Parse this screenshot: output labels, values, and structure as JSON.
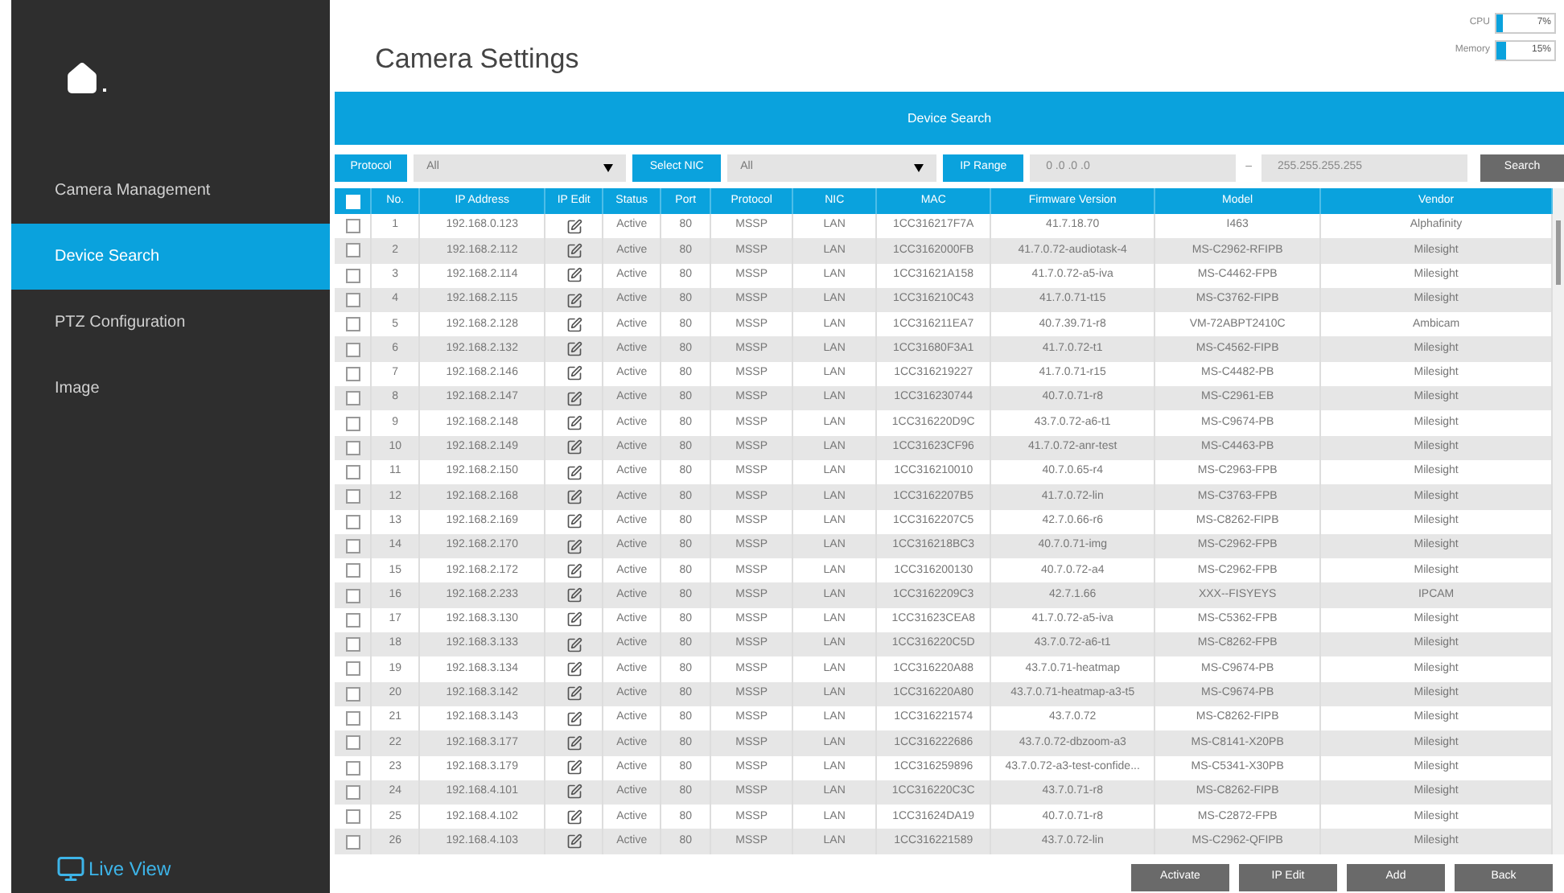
{
  "sidebar": {
    "items": [
      {
        "label": "Camera Management",
        "selected": false
      },
      {
        "label": "Device Search",
        "selected": true
      },
      {
        "label": "PTZ Configuration",
        "selected": false
      },
      {
        "label": "Image",
        "selected": false
      }
    ],
    "live_view": "Live View"
  },
  "header": {
    "title": "Camera Settings",
    "meters": [
      {
        "label": "CPU",
        "level": 0.07,
        "reading": "7%"
      },
      {
        "label": "Memory",
        "level": 0.15,
        "reading": "15%"
      }
    ]
  },
  "section_title": "Device Search",
  "filters": {
    "protocol": {
      "label": "Protocol",
      "value": "All"
    },
    "nic": {
      "label": "Select NIC",
      "value": "All"
    },
    "ip_range": {
      "label": "IP Range",
      "from": "0 .0 .0 .0",
      "separator": "–",
      "to": "255.255.255.255"
    },
    "search": "Search"
  },
  "table": {
    "select_all": {
      "checked": false
    },
    "columns": [
      "No.",
      "IP Address",
      "IP Edit",
      "Status",
      "Port",
      "Protocol",
      "NIC",
      "MAC",
      "Firmware Version",
      "Model",
      "Vendor"
    ],
    "rows": [
      {
        "checked": false,
        "cells": [
          "1",
          "192.168.0.123",
          "",
          "Active",
          "80",
          "MSSP",
          "LAN",
          "1CC316217F7A",
          "41.7.18.70",
          "I463",
          "Alphafinity"
        ]
      },
      {
        "checked": false,
        "cells": [
          "2",
          "192.168.2.112",
          "",
          "Active",
          "80",
          "MSSP",
          "LAN",
          "1CC3162000FB",
          "41.7.0.72-audiotask-4",
          "MS-C2962-RFIPB",
          "Milesight"
        ]
      },
      {
        "checked": false,
        "cells": [
          "3",
          "192.168.2.114",
          "",
          "Active",
          "80",
          "MSSP",
          "LAN",
          "1CC31621A158",
          "41.7.0.72-a5-iva",
          "MS-C4462-FPB",
          "Milesight"
        ]
      },
      {
        "checked": false,
        "cells": [
          "4",
          "192.168.2.115",
          "",
          "Active",
          "80",
          "MSSP",
          "LAN",
          "1CC316210C43",
          "41.7.0.71-t15",
          "MS-C3762-FIPB",
          "Milesight"
        ]
      },
      {
        "checked": false,
        "cells": [
          "5",
          "192.168.2.128",
          "",
          "Active",
          "80",
          "MSSP",
          "LAN",
          "1CC316211EA7",
          "40.7.39.71-r8",
          "VM-72ABPT2410C",
          "Ambicam"
        ]
      },
      {
        "checked": false,
        "cells": [
          "6",
          "192.168.2.132",
          "",
          "Active",
          "80",
          "MSSP",
          "LAN",
          "1CC31680F3A1",
          "41.7.0.72-t1",
          "MS-C4562-FIPB",
          "Milesight"
        ]
      },
      {
        "checked": false,
        "cells": [
          "7",
          "192.168.2.146",
          "",
          "Active",
          "80",
          "MSSP",
          "LAN",
          "1CC316219227",
          "41.7.0.71-r15",
          "MS-C4482-PB",
          "Milesight"
        ]
      },
      {
        "checked": false,
        "cells": [
          "8",
          "192.168.2.147",
          "",
          "Active",
          "80",
          "MSSP",
          "LAN",
          "1CC316230744",
          "40.7.0.71-r8",
          "MS-C2961-EB",
          "Milesight"
        ]
      },
      {
        "checked": false,
        "cells": [
          "9",
          "192.168.2.148",
          "",
          "Active",
          "80",
          "MSSP",
          "LAN",
          "1CC316220D9C",
          "43.7.0.72-a6-t1",
          "MS-C9674-PB",
          "Milesight"
        ]
      },
      {
        "checked": false,
        "cells": [
          "10",
          "192.168.2.149",
          "",
          "Active",
          "80",
          "MSSP",
          "LAN",
          "1CC31623CF96",
          "41.7.0.72-anr-test",
          "MS-C4463-PB",
          "Milesight"
        ]
      },
      {
        "checked": false,
        "cells": [
          "11",
          "192.168.2.150",
          "",
          "Active",
          "80",
          "MSSP",
          "LAN",
          "1CC316210010",
          "40.7.0.65-r4",
          "MS-C2963-FPB",
          "Milesight"
        ]
      },
      {
        "checked": false,
        "cells": [
          "12",
          "192.168.2.168",
          "",
          "Active",
          "80",
          "MSSP",
          "LAN",
          "1CC3162207B5",
          "41.7.0.72-lin",
          "MS-C3763-FPB",
          "Milesight"
        ]
      },
      {
        "checked": false,
        "cells": [
          "13",
          "192.168.2.169",
          "",
          "Active",
          "80",
          "MSSP",
          "LAN",
          "1CC3162207C5",
          "42.7.0.66-r6",
          "MS-C8262-FIPB",
          "Milesight"
        ]
      },
      {
        "checked": false,
        "cells": [
          "14",
          "192.168.2.170",
          "",
          "Active",
          "80",
          "MSSP",
          "LAN",
          "1CC316218BC3",
          "40.7.0.71-img",
          "MS-C2962-FPB",
          "Milesight"
        ]
      },
      {
        "checked": false,
        "cells": [
          "15",
          "192.168.2.172",
          "",
          "Active",
          "80",
          "MSSP",
          "LAN",
          "1CC316200130",
          "40.7.0.72-a4",
          "MS-C2962-FPB",
          "Milesight"
        ]
      },
      {
        "checked": false,
        "cells": [
          "16",
          "192.168.2.233",
          "",
          "Active",
          "80",
          "MSSP",
          "LAN",
          "1CC3162209C3",
          "42.7.1.66",
          "XXX--FISYEYS",
          "IPCAM"
        ]
      },
      {
        "checked": false,
        "cells": [
          "17",
          "192.168.3.130",
          "",
          "Active",
          "80",
          "MSSP",
          "LAN",
          "1CC31623CEA8",
          "41.7.0.72-a5-iva",
          "MS-C5362-FPB",
          "Milesight"
        ]
      },
      {
        "checked": false,
        "cells": [
          "18",
          "192.168.3.133",
          "",
          "Active",
          "80",
          "MSSP",
          "LAN",
          "1CC316220C5D",
          "43.7.0.72-a6-t1",
          "MS-C8262-FPB",
          "Milesight"
        ]
      },
      {
        "checked": false,
        "cells": [
          "19",
          "192.168.3.134",
          "",
          "Active",
          "80",
          "MSSP",
          "LAN",
          "1CC316220A88",
          "43.7.0.71-heatmap",
          "MS-C9674-PB",
          "Milesight"
        ]
      },
      {
        "checked": false,
        "cells": [
          "20",
          "192.168.3.142",
          "",
          "Active",
          "80",
          "MSSP",
          "LAN",
          "1CC316220A80",
          "43.7.0.71-heatmap-a3-t5",
          "MS-C9674-PB",
          "Milesight"
        ]
      },
      {
        "checked": false,
        "cells": [
          "21",
          "192.168.3.143",
          "",
          "Active",
          "80",
          "MSSP",
          "LAN",
          "1CC316221574",
          "43.7.0.72",
          "MS-C8262-FIPB",
          "Milesight"
        ]
      },
      {
        "checked": false,
        "cells": [
          "22",
          "192.168.3.177",
          "",
          "Active",
          "80",
          "MSSP",
          "LAN",
          "1CC316222686",
          "43.7.0.72-dbzoom-a3",
          "MS-C8141-X20PB",
          "Milesight"
        ]
      },
      {
        "checked": false,
        "cells": [
          "23",
          "192.168.3.179",
          "",
          "Active",
          "80",
          "MSSP",
          "LAN",
          "1CC316259896",
          "43.7.0.72-a3-test-confide...",
          "MS-C5341-X30PB",
          "Milesight"
        ]
      },
      {
        "checked": false,
        "cells": [
          "24",
          "192.168.4.101",
          "",
          "Active",
          "80",
          "MSSP",
          "LAN",
          "1CC316220C3C",
          "43.7.0.71-r8",
          "MS-C8262-FIPB",
          "Milesight"
        ]
      },
      {
        "checked": false,
        "cells": [
          "25",
          "192.168.4.102",
          "",
          "Active",
          "80",
          "MSSP",
          "LAN",
          "1CC31624DA19",
          "40.7.0.71-r8",
          "MS-C2872-FPB",
          "Milesight"
        ]
      },
      {
        "checked": false,
        "cells": [
          "26",
          "192.168.4.103",
          "",
          "Active",
          "80",
          "MSSP",
          "LAN",
          "1CC316221589",
          "43.7.0.72-lin",
          "MS-C2962-QFIPB",
          "Milesight"
        ]
      }
    ]
  },
  "buttons": [
    "Activate",
    "IP Edit",
    "Add",
    "Back"
  ]
}
